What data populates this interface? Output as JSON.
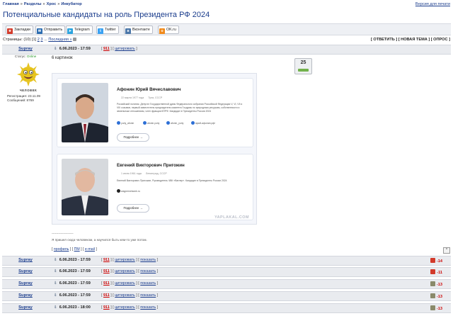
{
  "breadcrumbs": [
    "Главная",
    "Разделы",
    "Хрос",
    "Инкубатор"
  ],
  "breadcrumb_sep": "»",
  "full_version": "Версия для печати",
  "title": "Потенциальные кандидаты на роль Президента РФ 2024",
  "share": [
    {
      "label": "Закладки",
      "icon": "bookmark-icon",
      "color": "#d23a2a"
    },
    {
      "label": "Отправить",
      "icon": "mail-icon",
      "color": "#2b6cb0"
    },
    {
      "label": "Telegram",
      "icon": "telegram-icon",
      "color": "#2aa3de"
    },
    {
      "label": "Twitter",
      "icon": "twitter-icon",
      "color": "#3aa1f2"
    },
    {
      "label": "Вконтакте",
      "icon": "vk-icon",
      "color": "#4a76a8"
    },
    {
      "label": "OK.ru",
      "icon": "ok-icon",
      "color": "#f08a1b"
    }
  ],
  "pages": {
    "label": "Страницы:",
    "count": "(10)",
    "current": "[1]",
    "p2": "2",
    "p3": "3",
    "dots": "...",
    "last": "Последняя »"
  },
  "topic_actions": "[ ОТВЕТИТЬ ] [ НОВАЯ ТЕМА ] [ ОПРОС ]",
  "first_post": {
    "author": "Supray",
    "date": "6.06.2023 - 17:59",
    "reply_num": "911",
    "quote": "цитировать",
    "status_label": "Статус:",
    "status_value": "Online",
    "avatar_caption": "ЧЕЛОВЕК",
    "reg": "Регистрация: 23.11.09",
    "msgs": "Сообщений: 8769",
    "text": "6 картинок",
    "rating": "25",
    "candidates": [
      {
        "name": "Афонин Юрий Вячеславович",
        "birth": "22 марта 1977 года",
        "place": "Тула, СССР",
        "desc": "Российский политик. Депутат Государственной думы Федерального собрания Российской Федерации V, VI, VII и VIII созывов, первый заместитель председателя комитета Госдумы по природным ресурсам, собственности и земельным отношениям, член фракции КПРФ. Кандидат в Президенты России 2024",
        "social": [
          "yuriy_afonin",
          "afonin.yuriy",
          "afonin_yuriy",
          "юрий-афонин.рф/"
        ],
        "more": "Подробнее"
      },
      {
        "name": "Евгений Викторович Пригожин",
        "birth": "1 июня 1961 года",
        "place": "Ленинград, СССР",
        "desc": "Евгений Викторович Пригожин, Руководитель ЧВК «Вагнер». Кандидат в Президенты России 2024",
        "social": [
          "wagnernetwork.ru"
        ],
        "more": "Подробнее"
      }
    ],
    "watermark": "YAPLAKAL.COM",
    "sig_line": "--------------------",
    "sig_text": "Я пришел сюда человеком, а научился быть кем-то уже потом.",
    "links": {
      "profile": "профиль",
      "pm": "ПМ",
      "email": "e-mail"
    },
    "to_top": "^"
  },
  "replies": [
    {
      "author": "Supray",
      "date": "6.06.2023 - 17:59",
      "num": "911",
      "quote": "цитировать",
      "show": "показать",
      "score": "-14",
      "color": "#d23a2a"
    },
    {
      "author": "Supray",
      "date": "6.06.2023 - 17:59",
      "num": "911",
      "quote": "цитировать",
      "show": "показать",
      "score": "-11",
      "color": "#d23a2a"
    },
    {
      "author": "Supray",
      "date": "6.06.2023 - 17:59",
      "num": "911",
      "quote": "цитировать",
      "show": "показать",
      "score": "-13",
      "color": "#8a8a6a"
    },
    {
      "author": "Supray",
      "date": "6.06.2023 - 17:59",
      "num": "911",
      "quote": "цитировать",
      "show": "показать",
      "score": "-13",
      "color": "#8a8a6a"
    },
    {
      "author": "Supray",
      "date": "6.06.2023 - 18:00",
      "num": "911",
      "quote": "цитировать",
      "show": "показать",
      "score": "-13",
      "color": "#8a8a6a"
    }
  ]
}
